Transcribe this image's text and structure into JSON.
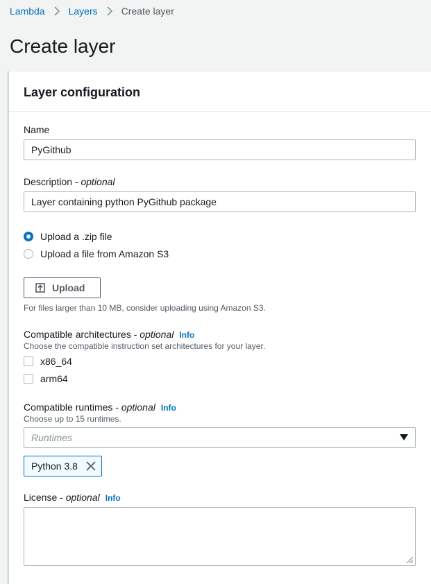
{
  "breadcrumb": {
    "items": [
      {
        "label": "Lambda"
      },
      {
        "label": "Layers"
      },
      {
        "label": "Create layer"
      }
    ]
  },
  "page": {
    "title": "Create layer"
  },
  "panel": {
    "title": "Layer configuration"
  },
  "name_field": {
    "label": "Name",
    "value": "PyGithub"
  },
  "description_field": {
    "label": "Description - ",
    "optional": "optional",
    "value": "Layer containing python PyGithub package"
  },
  "upload_options": [
    {
      "label": "Upload a .zip file",
      "selected": true
    },
    {
      "label": "Upload a file from Amazon S3",
      "selected": false
    }
  ],
  "upload": {
    "button_label": "Upload",
    "hint": "For files larger than 10 MB, consider uploading using Amazon S3."
  },
  "architectures": {
    "label": "Compatible architectures - ",
    "optional": "optional",
    "info": "Info",
    "description": "Choose the compatible instruction set architectures for your layer.",
    "options": [
      {
        "label": "x86_64",
        "checked": false
      },
      {
        "label": "arm64",
        "checked": false
      }
    ]
  },
  "runtimes": {
    "label": "Compatible runtimes - ",
    "optional": "optional",
    "info": "Info",
    "description": "Choose up to 15 runtimes.",
    "placeholder": "Runtimes",
    "selected_tokens": [
      {
        "label": "Python 3.8"
      }
    ]
  },
  "license": {
    "label": "License - ",
    "optional": "optional",
    "info": "Info",
    "value": ""
  },
  "colors": {
    "link": "#0073bb",
    "text": "#16191f",
    "muted": "#545b64",
    "border": "#aab7b8",
    "background": "#f2f3f3"
  }
}
